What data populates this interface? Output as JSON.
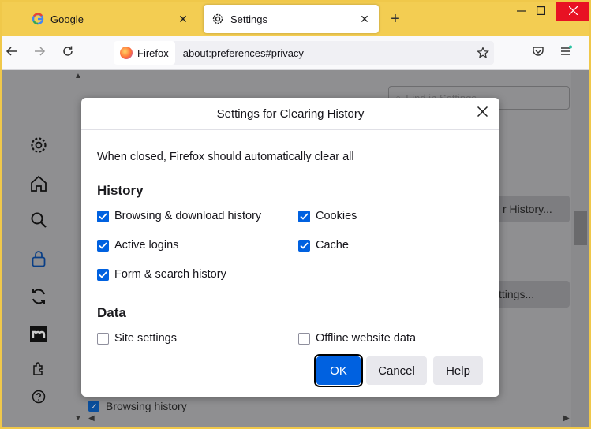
{
  "window": {
    "minimize_icon": "minimize-icon",
    "maximize_icon": "maximize-icon",
    "close_icon": "close-icon"
  },
  "tabs": [
    {
      "label": "Google",
      "icon": "google-icon",
      "active": false
    },
    {
      "label": "Settings",
      "icon": "gear-icon",
      "active": true
    }
  ],
  "new_tab_label": "+",
  "navbar": {
    "identity_label": "Firefox",
    "url": "about:preferences#privacy"
  },
  "background": {
    "find_placeholder": "Find in Settings",
    "clear_history_button": "r History...",
    "settings_button": "ttings...",
    "browsing_history_label": "Browsing history"
  },
  "dialog": {
    "title": "Settings for Clearing History",
    "description": "When closed, Firefox should automatically clear all",
    "history_heading": "History",
    "data_heading": "Data",
    "history_items": [
      {
        "label": "Browsing & download history",
        "checked": true
      },
      {
        "label": "Cookies",
        "checked": true
      },
      {
        "label": "Active logins",
        "checked": true
      },
      {
        "label": "Cache",
        "checked": true
      },
      {
        "label": "Form & search history",
        "checked": true
      }
    ],
    "data_items": [
      {
        "label": "Site settings",
        "checked": false
      },
      {
        "label": "Offline website data",
        "checked": false
      }
    ],
    "ok_label": "OK",
    "cancel_label": "Cancel",
    "help_label": "Help"
  },
  "colors": {
    "accent": "#0061e0",
    "titlebar": "#f3cd52",
    "close_red": "#e81123"
  }
}
